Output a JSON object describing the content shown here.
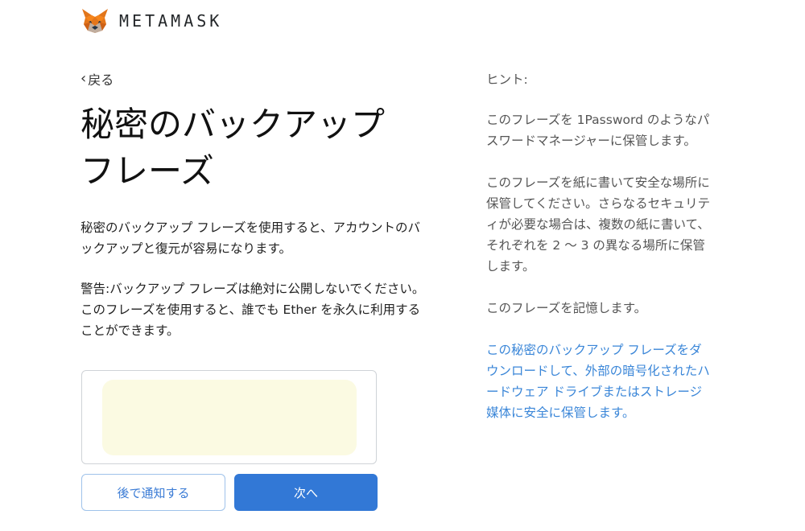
{
  "brand": {
    "name": "METAMASK",
    "logo_icon": "metamask-fox-icon",
    "colors": {
      "primary": "#3278d6",
      "link": "#3a86d8",
      "phrase_bg": "#fbfae2"
    }
  },
  "nav": {
    "back_icon": "chevron-left-icon",
    "back_label": "戻る"
  },
  "main": {
    "title": "秘密のバックアップ フレーズ",
    "description": "秘密のバックアップ フレーズを使用すると、アカウントのバックアップと復元が容易になります。",
    "warning": "警告:バックアップ フレーズは絶対に公開しないでください。このフレーズを使用すると、誰でも Ether を永久に利用することができます。",
    "remind_later_label": "後で通知する",
    "next_label": "次へ"
  },
  "hints": {
    "heading": "ヒント:",
    "items": [
      "このフレーズを 1Password のようなパスワードマネージャーに保管します。",
      "このフレーズを紙に書いて安全な場所に保管してください。さらなるセキュリティが必要な場合は、複数の紙に書いて、それぞれを 2 〜 3 の異なる場所に保管します。",
      "このフレーズを記憶します。"
    ],
    "download_link": "この秘密のバックアップ フレーズをダウンロードして、外部の暗号化されたハードウェア ドライブまたはストレージ媒体に安全に保管します。"
  }
}
